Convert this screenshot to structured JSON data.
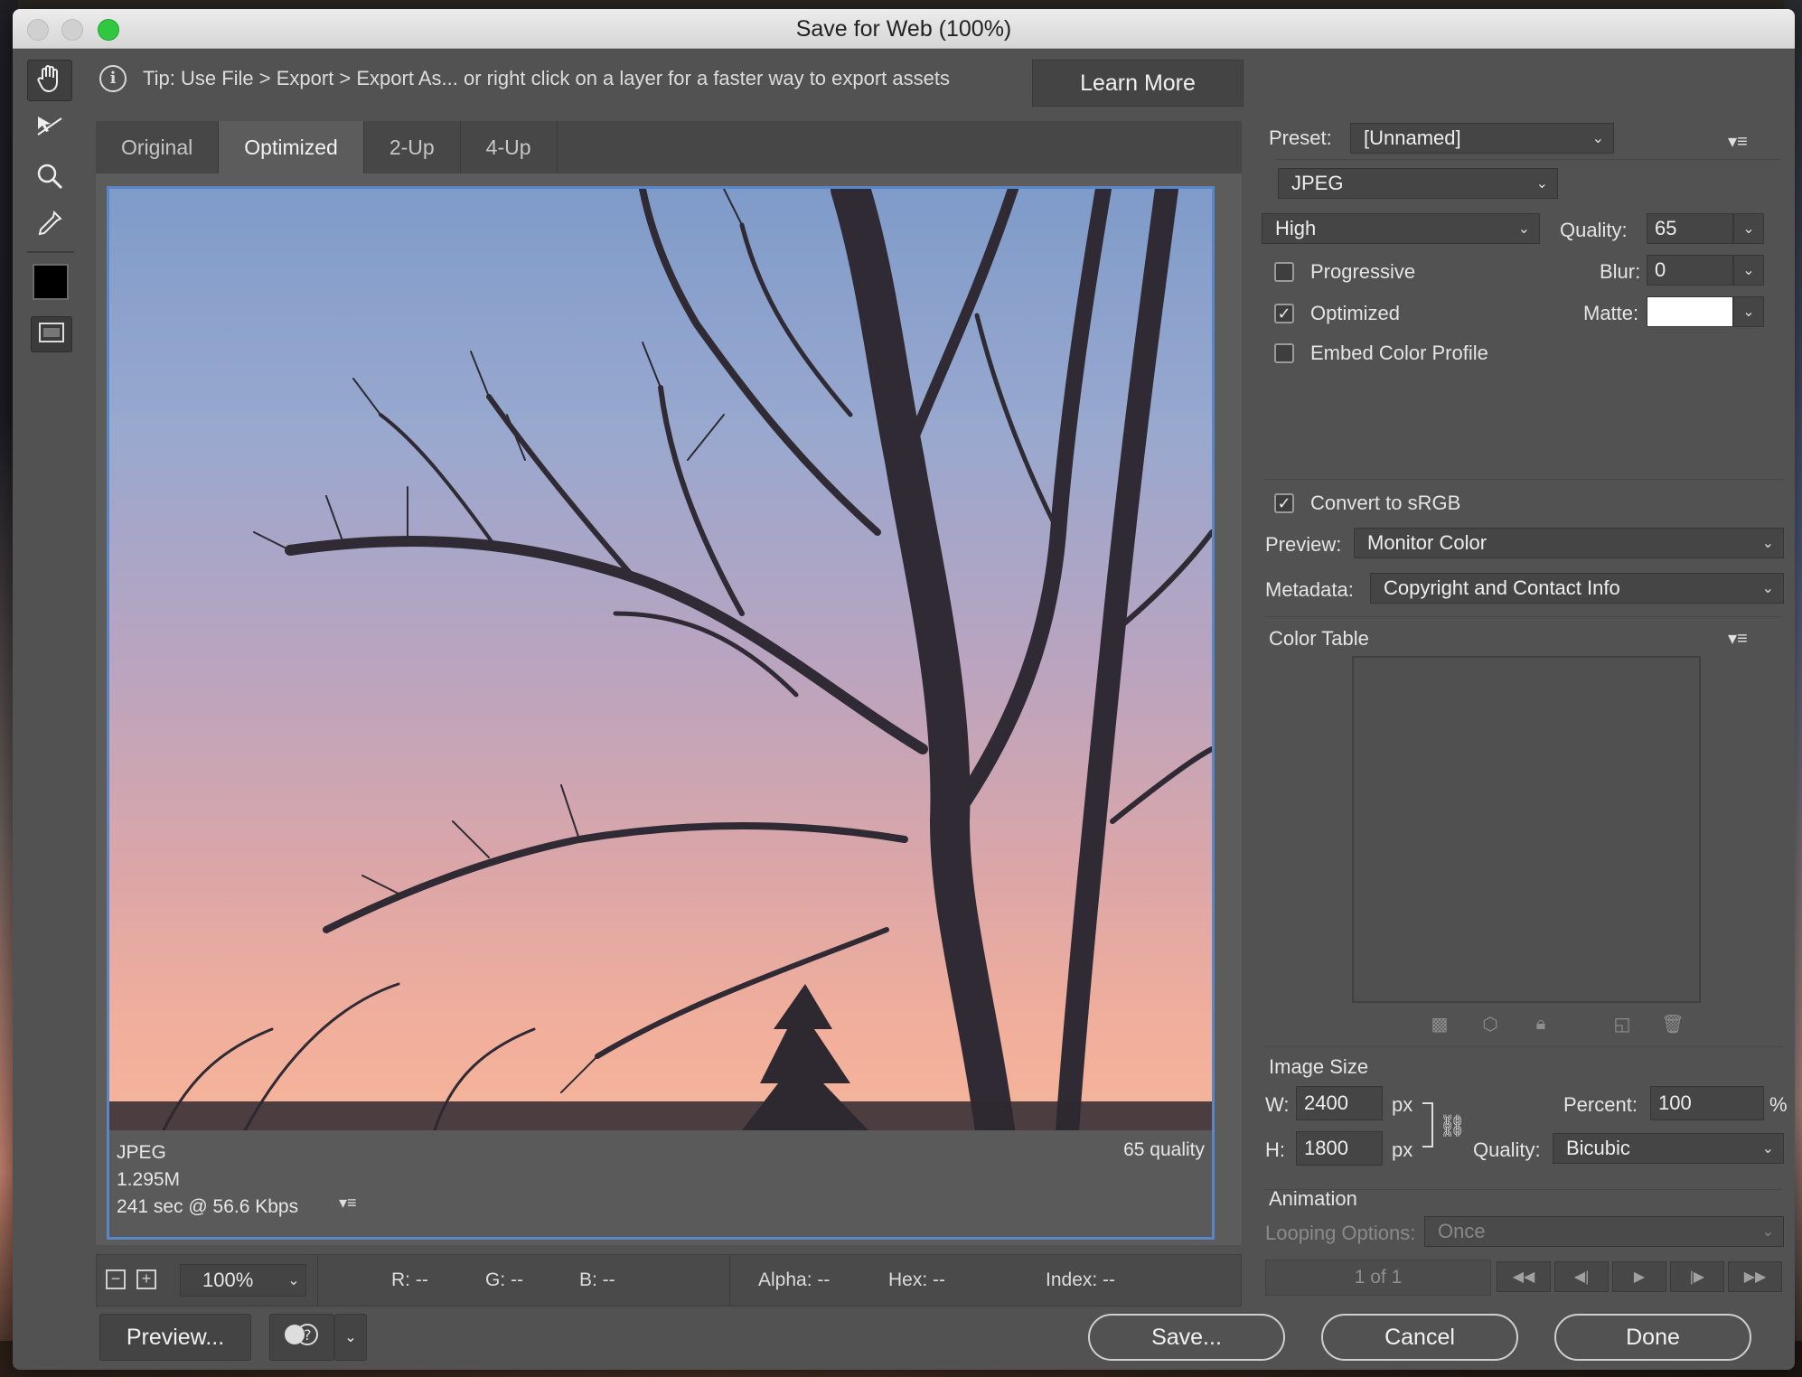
{
  "window": {
    "title": "Save for Web (100%)"
  },
  "tip": {
    "text": "Tip: Use File > Export > Export As...  or right click on a layer for a faster way to export assets",
    "learn_more": "Learn More"
  },
  "tools": [
    {
      "name": "hand-tool",
      "icon": "hand-icon"
    },
    {
      "name": "slice-select-tool",
      "icon": "slice-select-icon"
    },
    {
      "name": "zoom-tool",
      "icon": "magnifier-icon"
    },
    {
      "name": "eyedropper-tool",
      "icon": "eyedropper-icon"
    }
  ],
  "eyedropper_color": "#000000",
  "tabs": [
    "Original",
    "Optimized",
    "2-Up",
    "4-Up"
  ],
  "active_tab": "Optimized",
  "preview": {
    "format": "JPEG",
    "size": "1.295M",
    "time": "241 sec @ 56.6 Kbps",
    "quality_note": "65 quality"
  },
  "status": {
    "zoom": "100%",
    "r": "R: --",
    "g": "G: --",
    "b": "B: --",
    "alpha": "Alpha: --",
    "hex": "Hex: --",
    "index": "Index: --"
  },
  "buttons": {
    "preview": "Preview...",
    "save": "Save...",
    "cancel": "Cancel",
    "done": "Done"
  },
  "settings": {
    "preset_label": "Preset:",
    "preset": "[Unnamed]",
    "format": "JPEG",
    "compression": "High",
    "quality_label": "Quality:",
    "quality": "65",
    "progressive": "Progressive",
    "progressive_checked": false,
    "optimized": "Optimized",
    "optimized_checked": true,
    "embed_profile": "Embed Color Profile",
    "embed_profile_checked": false,
    "blur_label": "Blur:",
    "blur": "0",
    "matte_label": "Matte:",
    "matte_color": "#ffffff",
    "convert_srgb": "Convert to sRGB",
    "convert_srgb_checked": true,
    "preview_label": "Preview:",
    "preview_value": "Monitor Color",
    "metadata_label": "Metadata:",
    "metadata_value": "Copyright and Contact Info"
  },
  "color_table": {
    "title": "Color Table"
  },
  "image_size": {
    "title": "Image Size",
    "w_label": "W:",
    "w": "2400",
    "h_label": "H:",
    "h": "1800",
    "unit": "px",
    "percent_label": "Percent:",
    "percent": "100",
    "percent_unit": "%",
    "quality_label": "Quality:",
    "quality": "Bicubic"
  },
  "animation": {
    "title": "Animation",
    "looping_label": "Looping Options:",
    "looping": "Once",
    "frame": "1 of 1"
  }
}
